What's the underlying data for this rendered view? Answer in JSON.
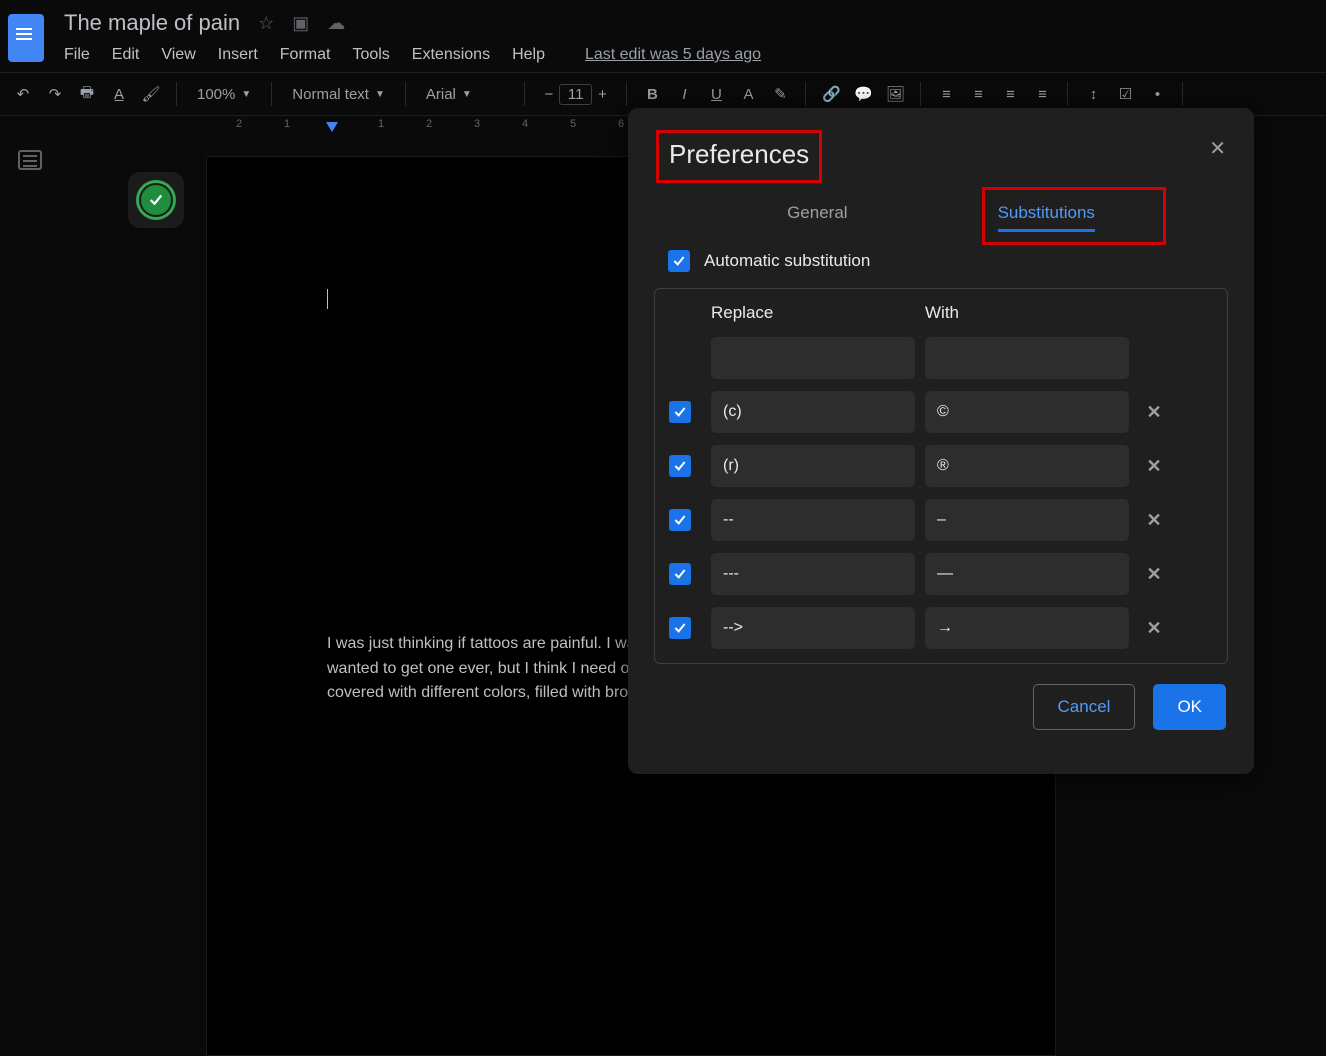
{
  "doc": {
    "title": "The maple of pain",
    "last_edit": "Last edit was 5 days ago"
  },
  "menu": {
    "file": "File",
    "edit": "Edit",
    "view": "View",
    "insert": "Insert",
    "format": "Format",
    "tools": "Tools",
    "extensions": "Extensions",
    "help": "Help"
  },
  "toolbar": {
    "zoom": "100%",
    "style": "Normal text",
    "font": "Arial",
    "font_size": "11"
  },
  "ruler": {
    "ticks": [
      "2",
      "1",
      "",
      "1",
      "2",
      "3",
      "4",
      "5",
      "6"
    ]
  },
  "body_text": "I was just thinking if tattoos are painful. I was not supposed to get one nor I ever wanted to get one ever, but I think I need one, something like a fresh piece of an eye covered with different colors, filled with broken pieces of glass, the one",
  "dialog": {
    "title": "Preferences",
    "tabs": {
      "general": "General",
      "subs": "Substitutions"
    },
    "auto_sub": "Automatic substitution",
    "head": {
      "replace": "Replace",
      "with": "With"
    },
    "rows": [
      {
        "enabled": true,
        "from": "(c)",
        "to": "©"
      },
      {
        "enabled": true,
        "from": "(r)",
        "to": "®"
      },
      {
        "enabled": true,
        "from": "--",
        "to": "–"
      },
      {
        "enabled": true,
        "from": "---",
        "to": "—"
      },
      {
        "enabled": true,
        "from": "-->",
        "to": "→"
      }
    ],
    "buttons": {
      "cancel": "Cancel",
      "ok": "OK"
    }
  }
}
